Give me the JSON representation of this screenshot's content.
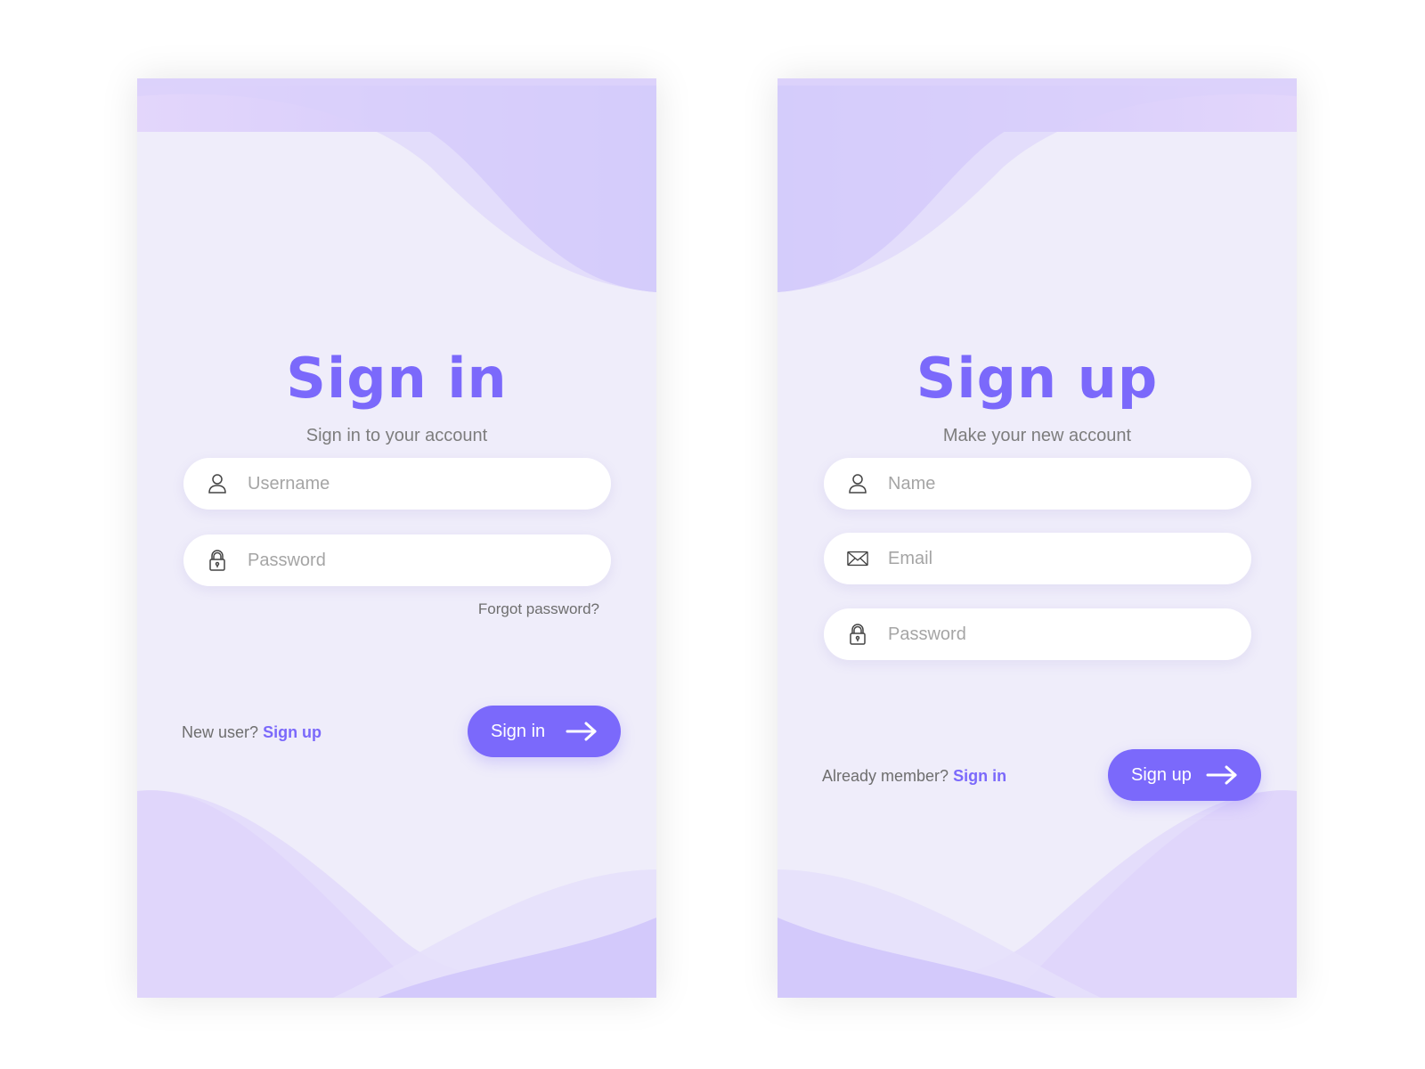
{
  "colors": {
    "accent": "#7b69fb",
    "card_bg": "#efedfa",
    "wave_dark": "#d2c8fb",
    "wave_light": "#e2d9fb",
    "muted_text": "#7d7d7d",
    "placeholder": "#a5a5a5"
  },
  "signin": {
    "title": "Sign in",
    "subtitle": "Sign in to your account",
    "fields": [
      {
        "icon": "user-icon",
        "placeholder": "Username",
        "value": ""
      },
      {
        "icon": "lock-icon",
        "placeholder": "Password",
        "value": ""
      }
    ],
    "forgot_label": "Forgot password?",
    "prompt_text": "New user?",
    "prompt_link": "Sign up",
    "button_label": "Sign in",
    "button_icon": "arrow-right-icon"
  },
  "signup": {
    "title": "Sign up",
    "subtitle": "Make your new account",
    "fields": [
      {
        "icon": "user-icon",
        "placeholder": "Name",
        "value": ""
      },
      {
        "icon": "mail-icon",
        "placeholder": "Email",
        "value": ""
      },
      {
        "icon": "lock-icon",
        "placeholder": "Password",
        "value": ""
      }
    ],
    "prompt_text": "Already member?",
    "prompt_link": "Sign in",
    "button_label": "Sign up",
    "button_icon": "arrow-right-icon"
  }
}
